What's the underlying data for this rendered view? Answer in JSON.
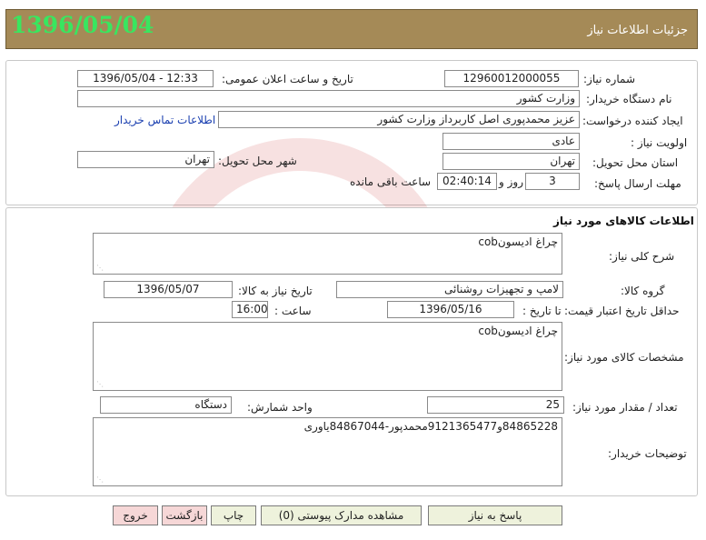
{
  "header": {
    "date": "1396/05/04",
    "title": "جزئیات اطلاعات نیاز"
  },
  "details": {
    "need_number_label": "شماره نیاز:",
    "need_number": "12960012000055",
    "announce_label": "تاریخ و ساعت اعلان عمومی:",
    "announce_value": "1396/05/04 - 12:33",
    "buyer_org_label": "نام دستگاه خریدار:",
    "buyer_org": "وزارت کشور",
    "creator_label": "ایجاد کننده درخواست:",
    "creator": "عزیز محمدپوری اصل کاربرداز وزارت کشور",
    "buyer_contact_link": "اطلاعات تماس خریدار",
    "priority_label": "اولویت نیاز :",
    "priority": "عادی",
    "province_label": "استان محل تحویل:",
    "province": "تهران",
    "city_label": "شهر محل تحویل:",
    "city": "تهران",
    "deadline_label": "مهلت ارسال پاسخ:",
    "deadline_days": "3",
    "days_and": "روز و",
    "deadline_time": "02:40:14",
    "remaining_label": "ساعت باقی مانده"
  },
  "goods": {
    "section_title": "اطلاعات کالاهای مورد نیاز",
    "summary_label": "شرح کلی نیاز:",
    "summary": "چراغ ادیسونcob",
    "group_label": "گروه کالا:",
    "group": "لامپ و تجهیزات روشنائی",
    "need_date_label": "تاریخ نیاز به کالا:",
    "need_date": "1396/05/07",
    "price_validity_label": "حداقل تاریخ اعتبار قیمت:",
    "until_date_label": "تا تاریخ :",
    "until_date": "1396/05/16",
    "hour_label": "ساعت :",
    "hour": "16:00",
    "specs_label": "مشخصات کالای مورد نیاز:",
    "specs": "چراغ ادیسونcob",
    "quantity_label": "تعداد / مقدار مورد نیاز:",
    "quantity": "25",
    "unit_label": "واحد شمارش:",
    "unit": "دستگاه",
    "buyer_notes_label": "توضیحات خریدار:",
    "buyer_notes": "84865228و9121365477محمدپور-84867044یاوری"
  },
  "buttons": {
    "reply": "پاسخ به نیاز",
    "attachments": "مشاهده مدارک پیوستی (0)",
    "print": "چاپ",
    "back": "بازگشت",
    "exit": "خروج"
  },
  "colors": {
    "header_bg": "#a58a57",
    "header_date": "#39e65f",
    "button_bg": "#eef2dc",
    "button_pink": "#f6d7d7",
    "link": "#1a3fb0"
  }
}
